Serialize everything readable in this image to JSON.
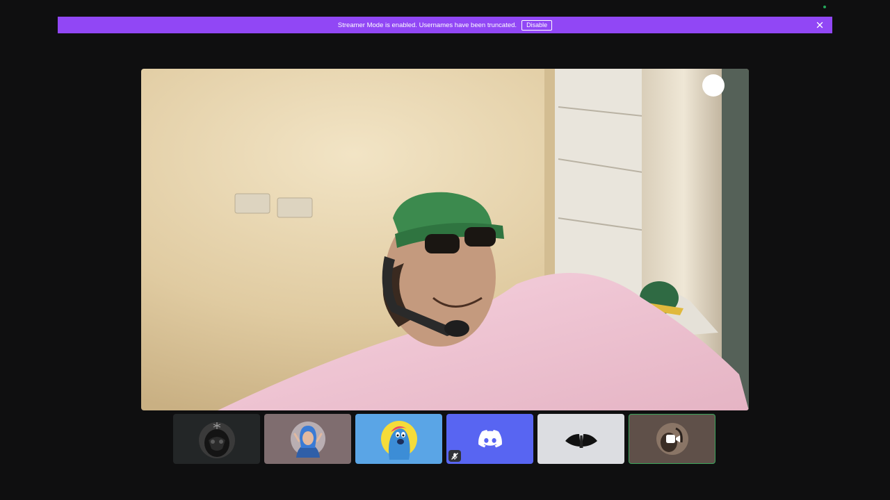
{
  "banner": {
    "message": "Streamer Mode is enabled. Usernames have been truncated.",
    "disable_label": "Disable",
    "color": "#9147f5"
  },
  "icons": {
    "banner_close": "close-icon",
    "discord_tile": "discord-logo-icon",
    "muted_badge": "mic-muted-icon",
    "camera_tile": "video-camera-icon"
  },
  "colors": {
    "background": "#0f0f10",
    "speaking_outline": "#3ba55c",
    "discord_blurple": "#5865f2",
    "online_dot": "#23a55a"
  }
}
